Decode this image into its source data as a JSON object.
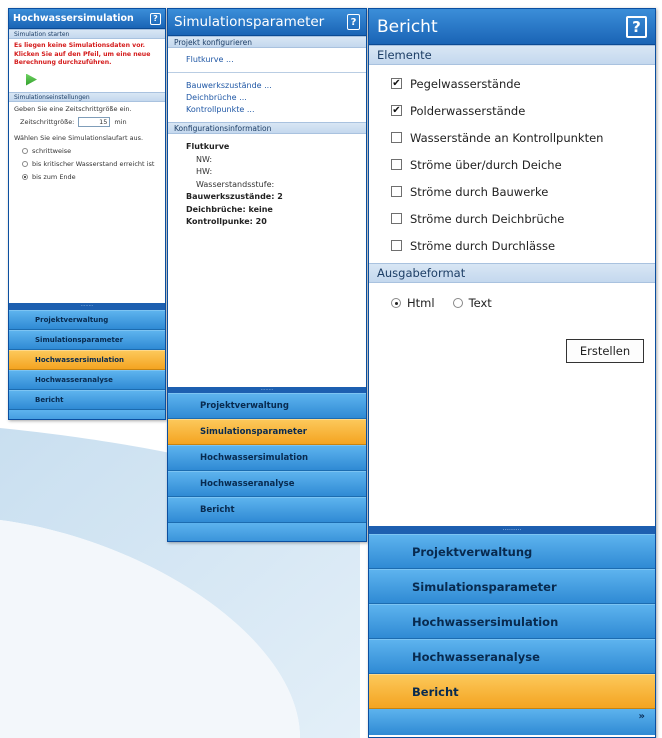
{
  "panel_sim": {
    "title": "Hochwassersimulation",
    "help": "?",
    "section_start": "Simulation starten",
    "error_line1": "Es liegen keine Simulationsdaten vor.",
    "error_line2": "Klicken Sie auf den Pfeil, um eine neue Berechnung durchzuführen.",
    "section_settings": "Simulationseinstellungen",
    "step_prompt": "Geben Sie eine Zeitschrittgröße ein.",
    "step_label": "Zeitschrittgröße:",
    "step_value": "15",
    "step_unit": "min",
    "run_prompt": "Wählen Sie eine Simulationslaufart aus.",
    "run_options": [
      "schrittweise",
      "bis kritischer Wasserstand erreicht ist",
      "bis zum Ende"
    ],
    "run_selected": "bis zum Ende",
    "splitter": "........"
  },
  "panel_params": {
    "title": "Simulationsparameter",
    "help": "?",
    "section_project": "Projekt konfigurieren",
    "link_flood": "Flutkurve ...",
    "link_structures": "Bauwerkszustände ...",
    "link_breaches": "Deichbrüche ...",
    "link_checkpoints": "Kontrollpunkte ...",
    "section_info": "Konfigurationsinformation",
    "info_flood": "Flutkurve",
    "info_nw": "NW:",
    "info_hw": "HW:",
    "info_level": "Wasserstandsstufe:",
    "info_structures": "Bauwerkszustände: 2",
    "info_breaches": "Deichbrüche: keine",
    "info_checkpoints": "Kontrollpunke: 20",
    "splitter": "........"
  },
  "panel_report": {
    "title": "Bericht",
    "help": "?",
    "section_elements": "Elemente",
    "elements": [
      {
        "label": "Pegelwasserstände",
        "checked": true
      },
      {
        "label": "Polderwasserstände",
        "checked": true
      },
      {
        "label": "Wasserstände an Kontrollpunkten",
        "checked": false
      },
      {
        "label": "Ströme über/durch Deiche",
        "checked": false
      },
      {
        "label": "Ströme durch Bauwerke",
        "checked": false
      },
      {
        "label": "Ströme durch Deichbrüche",
        "checked": false
      },
      {
        "label": "Ströme durch Durchlässe",
        "checked": false
      }
    ],
    "section_format": "Ausgabeformat",
    "format_html": "Html",
    "format_text": "Text",
    "format_selected": "Html",
    "create_button": "Erstellen",
    "splitter": "..........",
    "more_icon": "»"
  },
  "nav_items": [
    "Projektverwaltung",
    "Simulationsparameter",
    "Hochwassersimulation",
    "Hochwasseranalyse",
    "Bericht"
  ],
  "active_nav": {
    "panel_sim": "Hochwassersimulation",
    "panel_params": "Simulationsparameter",
    "panel_report": "Bericht"
  },
  "colors": {
    "titlebar": "#1a64b5",
    "nav_blue": "#2f8ad4",
    "nav_active": "#f4a421",
    "error_red": "#d41b1b",
    "link_blue": "#1f57a5"
  }
}
